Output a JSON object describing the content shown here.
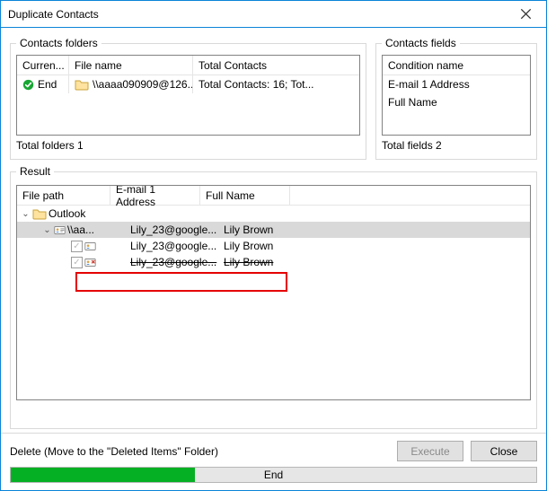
{
  "window": {
    "title": "Duplicate Contacts"
  },
  "folders": {
    "legend": "Contacts folders",
    "cols": {
      "status": "Curren...",
      "file": "File name",
      "total": "Total Contacts"
    },
    "row": {
      "status": "End",
      "file": "\\\\aaaa090909@126...",
      "total": "Total Contacts: 16; Tot..."
    },
    "footer": "Total folders  1"
  },
  "fields": {
    "legend": "Contacts fields",
    "col": "Condition name",
    "rows": [
      "E-mail 1 Address",
      "Full Name"
    ],
    "footer": "Total fields  2"
  },
  "result": {
    "legend": "Result",
    "cols": {
      "path": "File path",
      "email": "E-mail 1 Address",
      "name": "Full Name"
    },
    "tree": {
      "root": "Outlook",
      "group": "\\\\aa...",
      "items": [
        {
          "email": "Lily_23@google...",
          "name": "Lily Brown",
          "variant": "header"
        },
        {
          "email": "Lily_23@google...",
          "name": "Lily Brown",
          "variant": "keep"
        },
        {
          "email": "Lily_23@google...",
          "name": "Lily Brown",
          "variant": "delete"
        }
      ]
    }
  },
  "bottom": {
    "action": "Delete (Move to the \"Deleted Items\" Folder)",
    "execute": "Execute",
    "close": "Close",
    "progress": "End"
  }
}
